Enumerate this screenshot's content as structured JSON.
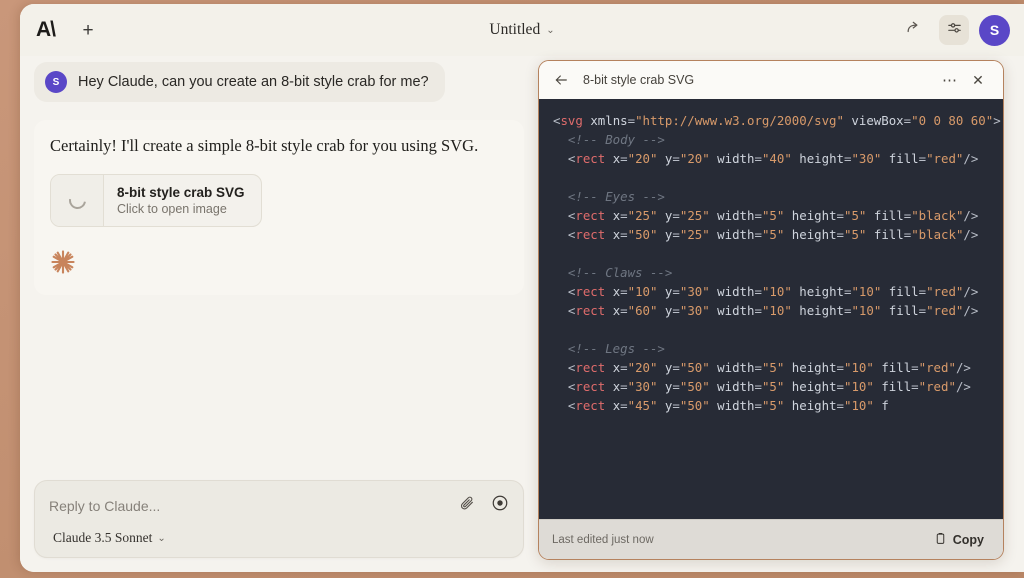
{
  "window": {
    "logo": "A\\",
    "title": "Untitled",
    "title_caret": "⌄"
  },
  "topbar": {
    "new_chat_label": "+",
    "icons": {
      "share": "share-arrow-icon",
      "settings": "sliders-icon"
    },
    "avatar_initial": "S"
  },
  "conversation": {
    "user_message": {
      "avatar_initial": "S",
      "text": "Hey Claude, can you create an 8-bit style crab for me?"
    },
    "assistant_message": {
      "text": "Certainly! I'll create a simple 8-bit style crab for you using SVG.",
      "artifact": {
        "title": "8-bit style crab SVG",
        "subtitle": "Click to open image",
        "thumb_icon": "loading-spinner-icon"
      },
      "status_icon": "claude-starburst-icon"
    }
  },
  "composer": {
    "placeholder": "Reply to Claude...",
    "value": "",
    "attach_icon": "paperclip-icon",
    "capture_icon": "record-circle-icon",
    "model": "Claude 3.5 Sonnet",
    "model_caret": "⌄"
  },
  "artifact_panel": {
    "header": {
      "back_icon": "arrow-left-icon",
      "title": "8-bit style crab SVG",
      "more_label": "⋯",
      "close_label": "✕"
    },
    "code_lines": [
      [
        {
          "t": "punc",
          "v": "<"
        },
        {
          "t": "tag",
          "v": "svg"
        },
        {
          "t": "attr",
          "v": " xmlns"
        },
        {
          "t": "punc",
          "v": "="
        },
        {
          "t": "str",
          "v": "\"http://www.w3.org/2000/svg\""
        },
        {
          "t": "attr",
          "v": " viewBox"
        },
        {
          "t": "punc",
          "v": "="
        },
        {
          "t": "str",
          "v": "\"0 0 80 60\""
        },
        {
          "t": "punc",
          "v": ">"
        }
      ],
      [
        {
          "t": "com",
          "v": "  <!-- Body -->"
        }
      ],
      [
        {
          "t": "punc",
          "v": "  <"
        },
        {
          "t": "tag",
          "v": "rect"
        },
        {
          "t": "attr",
          "v": " x"
        },
        {
          "t": "punc",
          "v": "="
        },
        {
          "t": "str",
          "v": "\"20\""
        },
        {
          "t": "attr",
          "v": " y"
        },
        {
          "t": "punc",
          "v": "="
        },
        {
          "t": "str",
          "v": "\"20\""
        },
        {
          "t": "attr",
          "v": " width"
        },
        {
          "t": "punc",
          "v": "="
        },
        {
          "t": "str",
          "v": "\"40\""
        },
        {
          "t": "attr",
          "v": " height"
        },
        {
          "t": "punc",
          "v": "="
        },
        {
          "t": "str",
          "v": "\"30\""
        },
        {
          "t": "attr",
          "v": " fill"
        },
        {
          "t": "punc",
          "v": "="
        },
        {
          "t": "str",
          "v": "\"red\""
        },
        {
          "t": "punc",
          "v": "/>"
        }
      ],
      [],
      [
        {
          "t": "com",
          "v": "  <!-- Eyes -->"
        }
      ],
      [
        {
          "t": "punc",
          "v": "  <"
        },
        {
          "t": "tag",
          "v": "rect"
        },
        {
          "t": "attr",
          "v": " x"
        },
        {
          "t": "punc",
          "v": "="
        },
        {
          "t": "str",
          "v": "\"25\""
        },
        {
          "t": "attr",
          "v": " y"
        },
        {
          "t": "punc",
          "v": "="
        },
        {
          "t": "str",
          "v": "\"25\""
        },
        {
          "t": "attr",
          "v": " width"
        },
        {
          "t": "punc",
          "v": "="
        },
        {
          "t": "str",
          "v": "\"5\""
        },
        {
          "t": "attr",
          "v": " height"
        },
        {
          "t": "punc",
          "v": "="
        },
        {
          "t": "str",
          "v": "\"5\""
        },
        {
          "t": "attr",
          "v": " fill"
        },
        {
          "t": "punc",
          "v": "="
        },
        {
          "t": "str",
          "v": "\"black\""
        },
        {
          "t": "punc",
          "v": "/>"
        }
      ],
      [
        {
          "t": "punc",
          "v": "  <"
        },
        {
          "t": "tag",
          "v": "rect"
        },
        {
          "t": "attr",
          "v": " x"
        },
        {
          "t": "punc",
          "v": "="
        },
        {
          "t": "str",
          "v": "\"50\""
        },
        {
          "t": "attr",
          "v": " y"
        },
        {
          "t": "punc",
          "v": "="
        },
        {
          "t": "str",
          "v": "\"25\""
        },
        {
          "t": "attr",
          "v": " width"
        },
        {
          "t": "punc",
          "v": "="
        },
        {
          "t": "str",
          "v": "\"5\""
        },
        {
          "t": "attr",
          "v": " height"
        },
        {
          "t": "punc",
          "v": "="
        },
        {
          "t": "str",
          "v": "\"5\""
        },
        {
          "t": "attr",
          "v": " fill"
        },
        {
          "t": "punc",
          "v": "="
        },
        {
          "t": "str",
          "v": "\"black\""
        },
        {
          "t": "punc",
          "v": "/>"
        }
      ],
      [],
      [
        {
          "t": "com",
          "v": "  <!-- Claws -->"
        }
      ],
      [
        {
          "t": "punc",
          "v": "  <"
        },
        {
          "t": "tag",
          "v": "rect"
        },
        {
          "t": "attr",
          "v": " x"
        },
        {
          "t": "punc",
          "v": "="
        },
        {
          "t": "str",
          "v": "\"10\""
        },
        {
          "t": "attr",
          "v": " y"
        },
        {
          "t": "punc",
          "v": "="
        },
        {
          "t": "str",
          "v": "\"30\""
        },
        {
          "t": "attr",
          "v": " width"
        },
        {
          "t": "punc",
          "v": "="
        },
        {
          "t": "str",
          "v": "\"10\""
        },
        {
          "t": "attr",
          "v": " height"
        },
        {
          "t": "punc",
          "v": "="
        },
        {
          "t": "str",
          "v": "\"10\""
        },
        {
          "t": "attr",
          "v": " fill"
        },
        {
          "t": "punc",
          "v": "="
        },
        {
          "t": "str",
          "v": "\"red\""
        },
        {
          "t": "punc",
          "v": "/>"
        }
      ],
      [
        {
          "t": "punc",
          "v": "  <"
        },
        {
          "t": "tag",
          "v": "rect"
        },
        {
          "t": "attr",
          "v": " x"
        },
        {
          "t": "punc",
          "v": "="
        },
        {
          "t": "str",
          "v": "\"60\""
        },
        {
          "t": "attr",
          "v": " y"
        },
        {
          "t": "punc",
          "v": "="
        },
        {
          "t": "str",
          "v": "\"30\""
        },
        {
          "t": "attr",
          "v": " width"
        },
        {
          "t": "punc",
          "v": "="
        },
        {
          "t": "str",
          "v": "\"10\""
        },
        {
          "t": "attr",
          "v": " height"
        },
        {
          "t": "punc",
          "v": "="
        },
        {
          "t": "str",
          "v": "\"10\""
        },
        {
          "t": "attr",
          "v": " fill"
        },
        {
          "t": "punc",
          "v": "="
        },
        {
          "t": "str",
          "v": "\"red\""
        },
        {
          "t": "punc",
          "v": "/>"
        }
      ],
      [],
      [
        {
          "t": "com",
          "v": "  <!-- Legs -->"
        }
      ],
      [
        {
          "t": "punc",
          "v": "  <"
        },
        {
          "t": "tag",
          "v": "rect"
        },
        {
          "t": "attr",
          "v": " x"
        },
        {
          "t": "punc",
          "v": "="
        },
        {
          "t": "str",
          "v": "\"20\""
        },
        {
          "t": "attr",
          "v": " y"
        },
        {
          "t": "punc",
          "v": "="
        },
        {
          "t": "str",
          "v": "\"50\""
        },
        {
          "t": "attr",
          "v": " width"
        },
        {
          "t": "punc",
          "v": "="
        },
        {
          "t": "str",
          "v": "\"5\""
        },
        {
          "t": "attr",
          "v": " height"
        },
        {
          "t": "punc",
          "v": "="
        },
        {
          "t": "str",
          "v": "\"10\""
        },
        {
          "t": "attr",
          "v": " fill"
        },
        {
          "t": "punc",
          "v": "="
        },
        {
          "t": "str",
          "v": "\"red\""
        },
        {
          "t": "punc",
          "v": "/>"
        }
      ],
      [
        {
          "t": "punc",
          "v": "  <"
        },
        {
          "t": "tag",
          "v": "rect"
        },
        {
          "t": "attr",
          "v": " x"
        },
        {
          "t": "punc",
          "v": "="
        },
        {
          "t": "str",
          "v": "\"30\""
        },
        {
          "t": "attr",
          "v": " y"
        },
        {
          "t": "punc",
          "v": "="
        },
        {
          "t": "str",
          "v": "\"50\""
        },
        {
          "t": "attr",
          "v": " width"
        },
        {
          "t": "punc",
          "v": "="
        },
        {
          "t": "str",
          "v": "\"5\""
        },
        {
          "t": "attr",
          "v": " height"
        },
        {
          "t": "punc",
          "v": "="
        },
        {
          "t": "str",
          "v": "\"10\""
        },
        {
          "t": "attr",
          "v": " fill"
        },
        {
          "t": "punc",
          "v": "="
        },
        {
          "t": "str",
          "v": "\"red\""
        },
        {
          "t": "punc",
          "v": "/>"
        }
      ],
      [
        {
          "t": "punc",
          "v": "  <"
        },
        {
          "t": "tag",
          "v": "rect"
        },
        {
          "t": "attr",
          "v": " x"
        },
        {
          "t": "punc",
          "v": "="
        },
        {
          "t": "str",
          "v": "\"45\""
        },
        {
          "t": "attr",
          "v": " y"
        },
        {
          "t": "punc",
          "v": "="
        },
        {
          "t": "str",
          "v": "\"50\""
        },
        {
          "t": "attr",
          "v": " width"
        },
        {
          "t": "punc",
          "v": "="
        },
        {
          "t": "str",
          "v": "\"5\""
        },
        {
          "t": "attr",
          "v": " height"
        },
        {
          "t": "punc",
          "v": "="
        },
        {
          "t": "str",
          "v": "\"10\""
        },
        {
          "t": "attr",
          "v": " f"
        }
      ]
    ],
    "footer": {
      "note": "Last edited just now",
      "copy_label": "Copy",
      "copy_icon": "clipboard-icon"
    }
  },
  "colors": {
    "desktop": "#c49173",
    "app_bg": "#f5f3ee",
    "accent_purple": "#5a47c7",
    "panel_border": "#b5825e",
    "code_bg": "#272b36",
    "claude_orange": "#c8845c"
  }
}
